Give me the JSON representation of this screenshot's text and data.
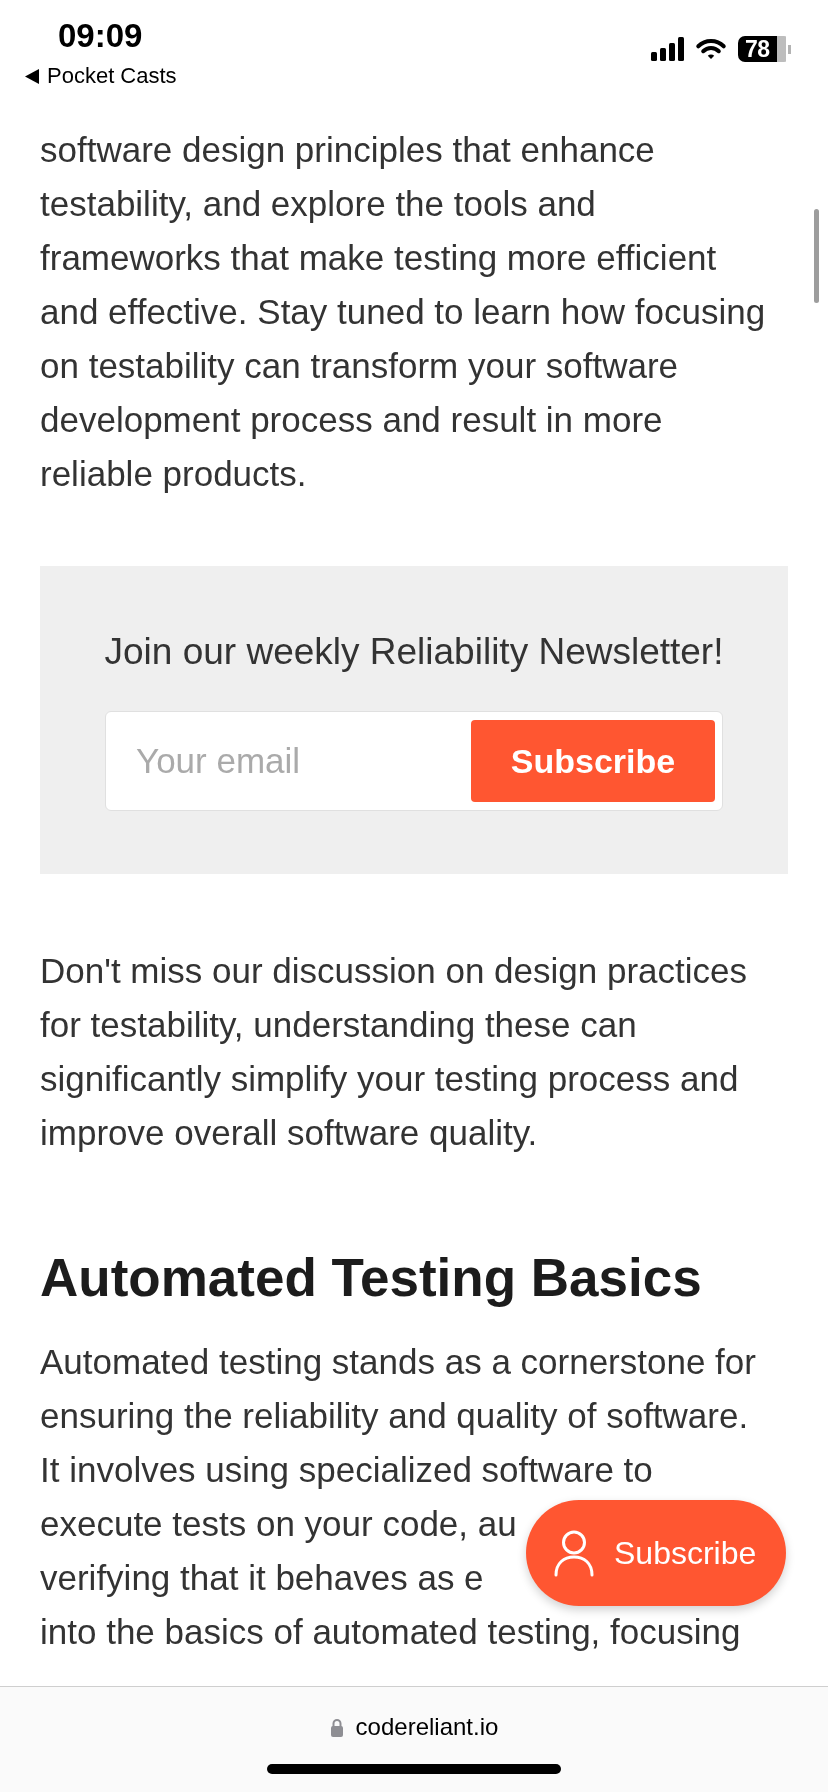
{
  "status_bar": {
    "time": "09:09",
    "back_link": "Pocket Casts",
    "battery": "78"
  },
  "article": {
    "blocks": [
      {
        "kind": "paragraph",
        "text": "software design principles that enhance testability, and explore the tools and frameworks that make testing more efficient and effective. Stay tuned to learn how focusing on testability can transform your software development process and result in more reliable products."
      },
      {
        "kind": "newsletter",
        "heading": "Join our weekly Reliability Newsletter!",
        "email_field": {
          "placeholder": "Your email"
        },
        "button": "Subscribe"
      },
      {
        "kind": "paragraph",
        "text": "Don't miss our discussion on design practices for testability, understanding these can significantly simplify your testing process and improve overall software quality."
      },
      {
        "kind": "heading",
        "text": "Automated Testing Basics"
      },
      {
        "kind": "covered_paragraph",
        "lines": [
          "Automated testing stands as a cornerstone for",
          "ensuring the reliability and quality of software.",
          "It involves using specialized software to",
          "execute tests on your code, au",
          "verifying that it behaves as e",
          "into the basics of automated testing, focusing"
        ]
      }
    ]
  },
  "floating_button": {
    "label": "Subscribe"
  },
  "browser_bar": {
    "address": "codereliant.io"
  }
}
